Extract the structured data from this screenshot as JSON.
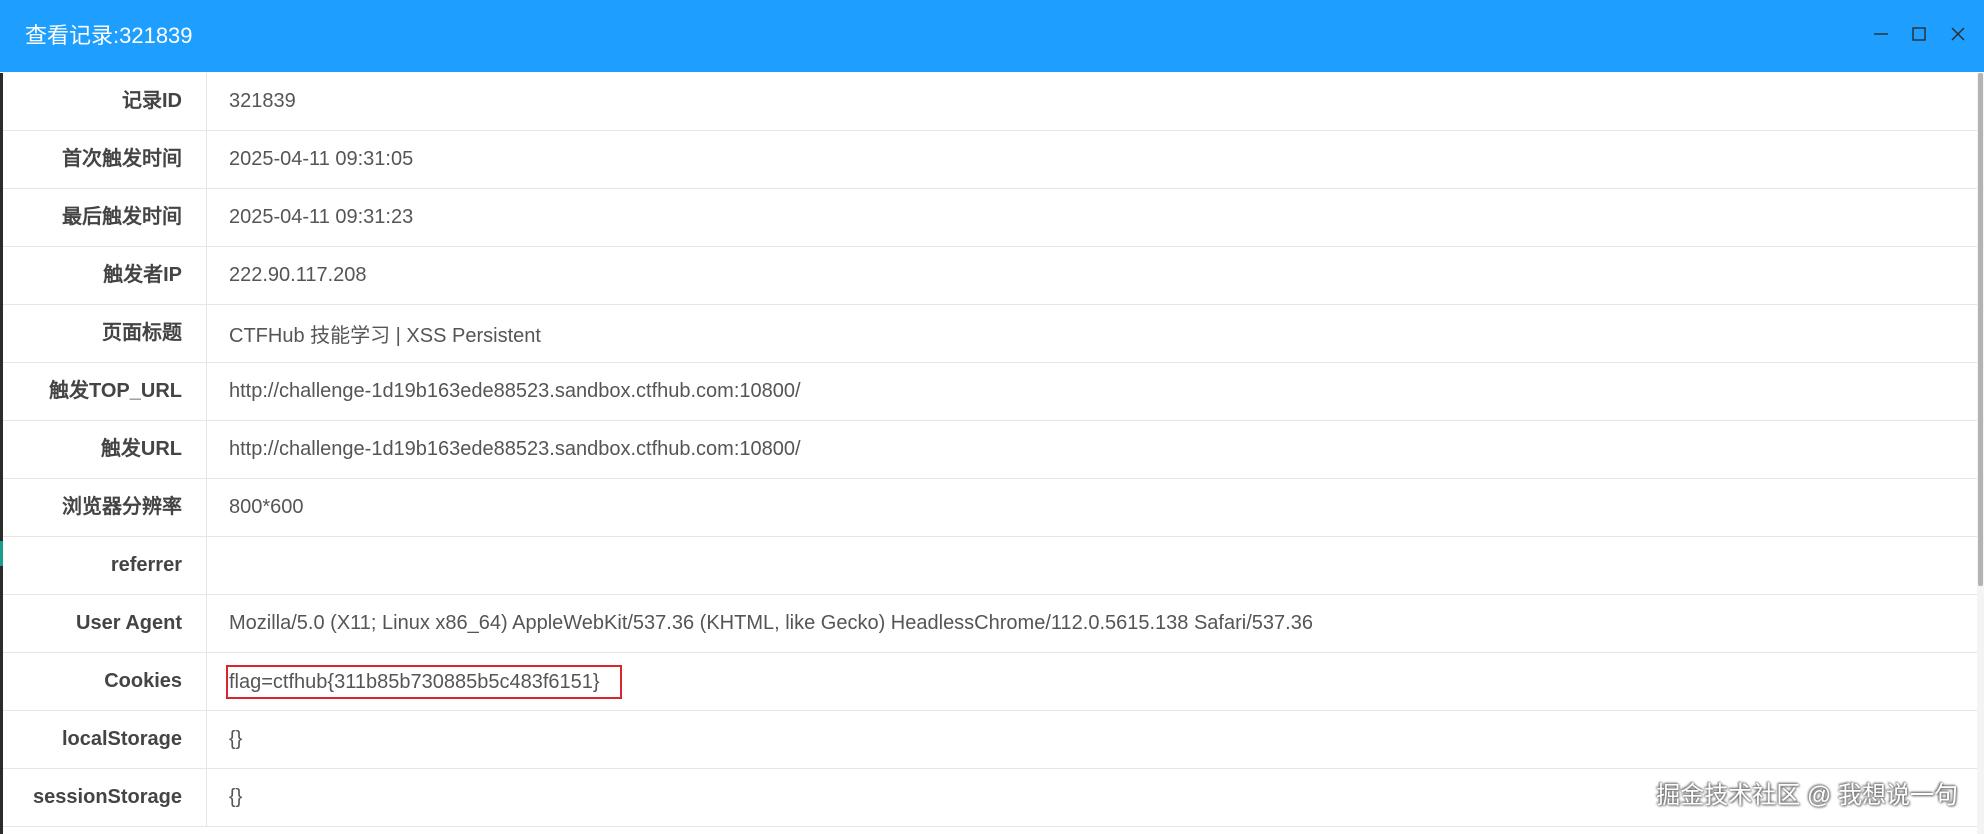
{
  "window": {
    "title": "查看记录:321839"
  },
  "icons": {
    "minimize": "minimize-icon",
    "maximize": "maximize-icon",
    "close": "close-icon"
  },
  "colors": {
    "accent": "#1E9FFF",
    "title_text": "#FFFFFF",
    "highlight": "#D9262C"
  },
  "rows": [
    {
      "label": "记录ID",
      "value": "321839"
    },
    {
      "label": "首次触发时间",
      "value": "2025-04-11 09:31:05"
    },
    {
      "label": "最后触发时间",
      "value": "2025-04-11 09:31:23"
    },
    {
      "label": "触发者IP",
      "value": "222.90.117.208"
    },
    {
      "label": "页面标题",
      "value": "CTFHub 技能学习 | XSS Persistent"
    },
    {
      "label": "触发TOP_URL",
      "value": "http://challenge-1d19b163ede88523.sandbox.ctfhub.com:10800/"
    },
    {
      "label": "触发URL",
      "value": "http://challenge-1d19b163ede88523.sandbox.ctfhub.com:10800/"
    },
    {
      "label": "浏览器分辨率",
      "value": "800*600"
    },
    {
      "label": "referrer",
      "value": ""
    },
    {
      "label": "User Agent",
      "value": "Mozilla/5.0 (X11; Linux x86_64) AppleWebKit/537.36 (KHTML, like Gecko) HeadlessChrome/112.0.5615.138 Safari/537.36"
    },
    {
      "label": "Cookies",
      "value": "flag=ctfhub{311b85b730885b5c483f6151}",
      "highlighted": true
    },
    {
      "label": "localStorage",
      "value": "{}"
    },
    {
      "label": "sessionStorage",
      "value": "{}"
    }
  ],
  "watermark": "掘金技术社区 @ 我想说一句"
}
